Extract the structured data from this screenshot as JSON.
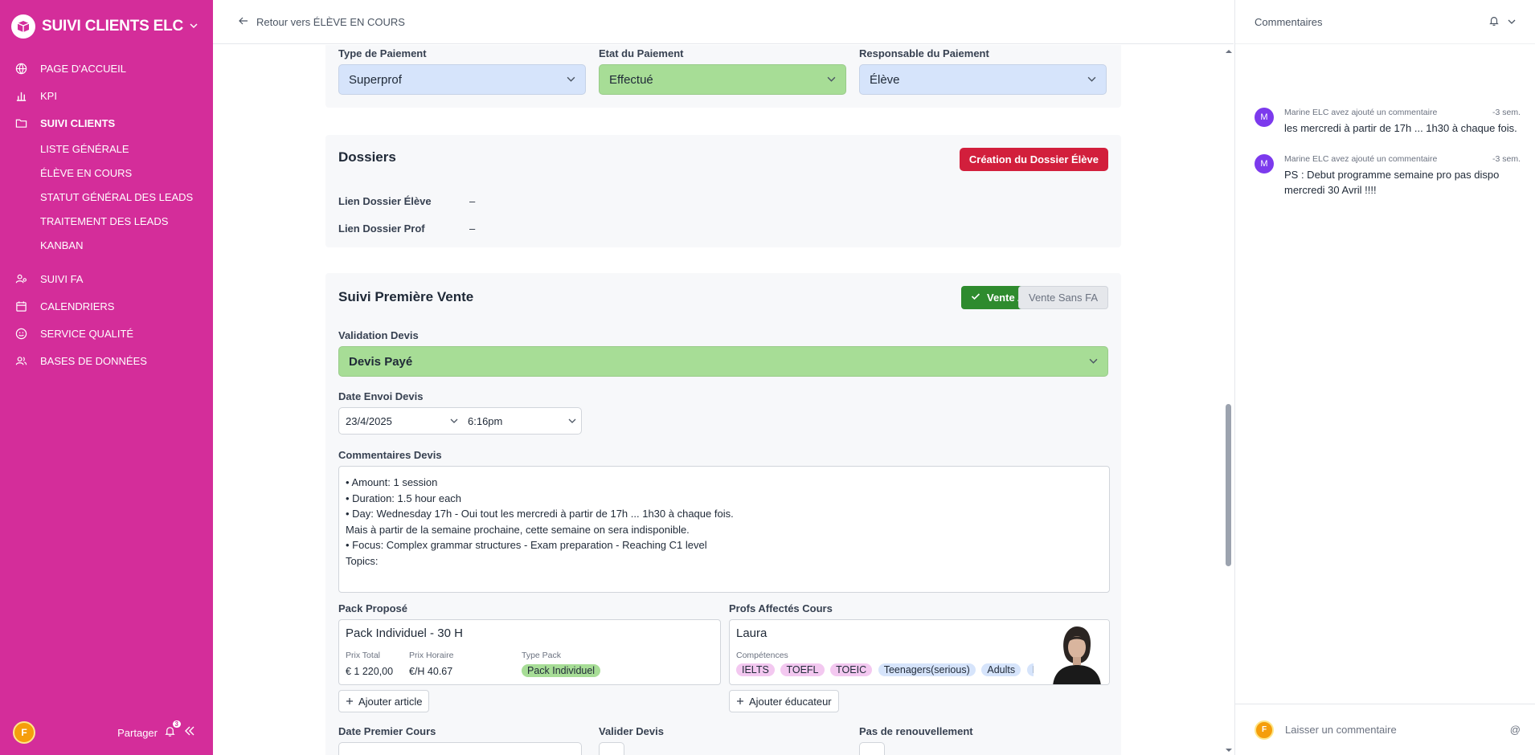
{
  "app": {
    "name": "SUIVI CLIENTS ELC"
  },
  "sidebar": {
    "items": [
      {
        "label": "PAGE D'ACCUEIL",
        "icon": "globe-icon"
      },
      {
        "label": "KPI",
        "icon": "bar-chart-icon"
      },
      {
        "label": "SUIVI CLIENTS",
        "icon": "folder-icon"
      },
      {
        "label": "SUIVI FA",
        "icon": "users-settings-icon"
      },
      {
        "label": "CALENDRIERS",
        "icon": "calendar-icon"
      },
      {
        "label": "SERVICE QUALITÉ",
        "icon": "smile-icon"
      },
      {
        "label": "BASES DE DONNÉES",
        "icon": "users-icon"
      }
    ],
    "sub_items": [
      "LISTE GÉNÉRALE",
      "ÉLÈVE EN COURS",
      "STATUT GÉNÉRAL DES LEADS",
      "TRAITEMENT DES LEADS",
      "KANBAN"
    ],
    "user_initial": "F",
    "share_label": "Partager",
    "notif_count": "3"
  },
  "topbar": {
    "back_label": "Retour vers ÉLÈVE EN COURS"
  },
  "payment": {
    "type_label": "Type de Paiement",
    "type_value": "Superprof",
    "state_label": "Etat du Paiement",
    "state_value": "Effectué",
    "resp_label": "Responsable du Paiement",
    "resp_value": "Élève"
  },
  "dossiers": {
    "title": "Dossiers",
    "create_button": "Création du Dossier Élève",
    "eleve_label": "Lien Dossier Élève",
    "eleve_value": "–",
    "prof_label": "Lien Dossier Prof",
    "prof_value": "–"
  },
  "vente": {
    "title": "Suivi Première Vente",
    "btn_avec": "Vente Avec FA",
    "btn_sans": "Vente Sans FA",
    "validation_label": "Validation Devis",
    "validation_value": "Devis Payé",
    "date_label": "Date Envoi Devis",
    "date_value": "23/4/2025",
    "time_value": "6:16pm",
    "comments_label": "Commentaires Devis",
    "comments_lines": [
      "•  Amount:  1 session",
      "•  Duration: 1.5 hour each",
      "•  Day:  Wednesday 17h - Oui tout les mercredi à partir de 17h ... 1h30 à chaque fois.",
      "Mais à partir de la semaine prochaine, cette semaine on sera indisponible.",
      "•  Focus: Complex grammar structures - Exam preparation - Reaching C1 level",
      "Topics:"
    ],
    "pack_label": "Pack Proposé",
    "pack_name": "Pack Individuel - 30 H",
    "prix_total_label": "Prix Total",
    "prix_total": "€ 1 220,00",
    "prix_horaire_label": "Prix Horaire",
    "prix_horaire": "€/H 40.67",
    "type_pack_label": "Type Pack",
    "type_pack": "Pack Individuel",
    "add_article": "Ajouter article",
    "profs_label": "Profs Affectés Cours",
    "prof_name": "Laura",
    "competences_label": "Compétences",
    "competences": [
      "IELTS",
      "TOEFL",
      "TOEIC",
      "Teenagers(serious)",
      "Adults",
      "Prof"
    ],
    "add_educ": "Ajouter éducateur",
    "first_course_label": "Date Premier Cours",
    "valider_label": "Valider Devis",
    "renouv_label": "Pas de renouvellement"
  },
  "comments_panel": {
    "title": "Commentaires",
    "items": [
      {
        "avatar": "M",
        "author": "Marine ELC",
        "action": "avez ajouté un commentaire",
        "time": "-3 sem.",
        "text": "les mercredi à partir de 17h ... 1h30 à chaque fois."
      },
      {
        "avatar": "M",
        "author": "Marine ELC",
        "action": "avez ajouté un commentaire",
        "time": "-3 sem.",
        "text": "PS : Debut programme semaine pro pas dispo mercredi 30 Avril !!!!"
      }
    ],
    "input_placeholder": "Laisser un commentaire",
    "user_initial": "F"
  },
  "colors": {
    "sidebar": "#d42d9a",
    "green_select": "#a7dd96",
    "blue_select": "#d6e4fb",
    "red_button": "#d21f3c",
    "green_button": "#2e8b2e"
  }
}
